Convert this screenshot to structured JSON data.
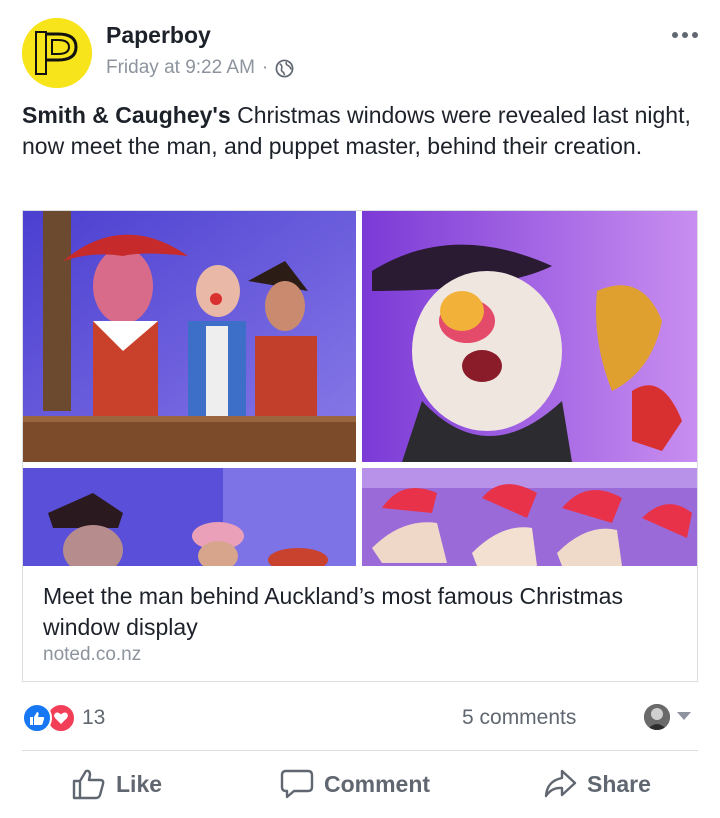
{
  "post": {
    "author": "Paperboy",
    "avatar_letter": "P",
    "avatar_side_text": "Paperboy",
    "timestamp": "Friday at 9:22 AM",
    "separator": "·",
    "privacy_icon": "globe-icon",
    "text_bold": "Smith & Caughey's",
    "text_rest": " Christmas windows were revealed last night, now meet the man, and puppet master, behind their creation."
  },
  "link_card": {
    "photos": [
      "puppets-on-balcony",
      "bearded-puppet-closeup",
      "pirate-puppets",
      "red-feathered-horses"
    ],
    "title": "Meet the man behind Auckland’s most famous Christmas window display",
    "domain": "noted.co.nz"
  },
  "engagement": {
    "reaction_icons": [
      "like-reaction-icon",
      "love-reaction-icon"
    ],
    "reaction_count": "13",
    "comments_label": "5 comments"
  },
  "actions": {
    "like": "Like",
    "comment": "Comment",
    "share": "Share"
  },
  "colors": {
    "accent": "#1877f2",
    "love": "#f33e58",
    "avatar_bg": "#f8e41a",
    "secondary_text": "#8d949e"
  }
}
